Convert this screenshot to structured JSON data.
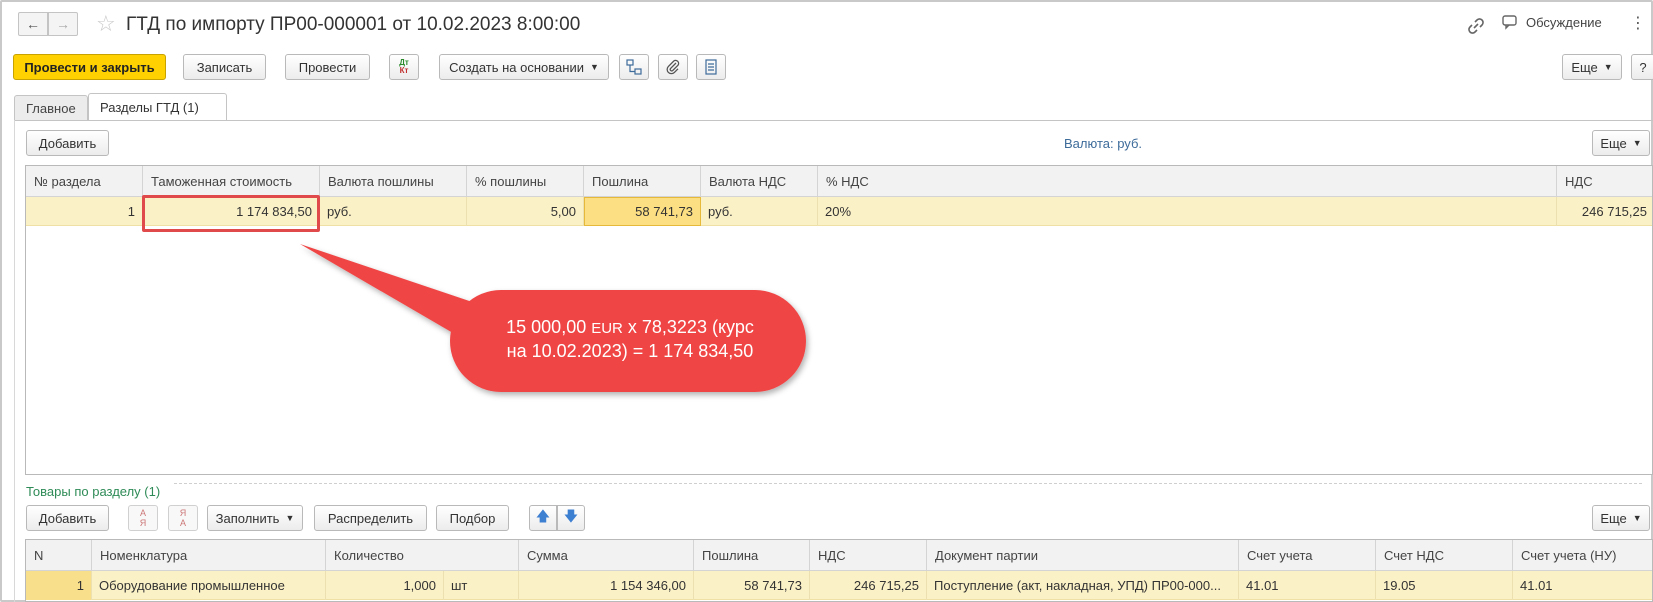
{
  "window": {
    "title": "ГТД по импорту ПР00-000001 от 10.02.2023 8:00:00",
    "discuss_label": "Обсуждение"
  },
  "toolbar": {
    "post_close_label": "Провести и закрыть",
    "save_label": "Записать",
    "post_label": "Провести",
    "dtkt_top": "Дт",
    "dtkt_bottom": "Кт",
    "create_based_label": "Создать на основании",
    "more_label": "Еще",
    "help_label": "?"
  },
  "tabs": [
    {
      "label": "Главное",
      "active": false
    },
    {
      "label": "Разделы ГТД (1)",
      "active": true
    }
  ],
  "sections": {
    "add_label": "Добавить",
    "currency_info": "Валюта: руб.",
    "more_label": "Еще",
    "columns": [
      "№ раздела",
      "Таможенная стоимость",
      "Валюта пошлины",
      "% пошлины",
      "Пошлина",
      "Валюта НДС",
      "% НДС",
      "НДС"
    ],
    "rows": [
      {
        "section_no": "1",
        "customs_value": "1 174 834,50",
        "duty_currency": "руб.",
        "duty_percent": "5,00",
        "duty": "58 741,73",
        "vat_currency": "руб.",
        "vat_percent": "20%",
        "vat": "246 715,25"
      }
    ]
  },
  "callout": {
    "line1_a": "15 000,00 ",
    "line1_unit": "EUR",
    "line1_b": " х 78,3223 (курс",
    "line2": "на 10.02.2023) = 1 174 834,50",
    "color": "#f04545"
  },
  "goods": {
    "title": "Товары по разделу (1)",
    "add_label": "Добавить",
    "sort_asc_top": "А",
    "sort_asc_bottom": "Я",
    "sort_desc_top": "Я",
    "sort_desc_bottom": "А",
    "fill_label": "Заполнить",
    "distribute_label": "Распределить",
    "select_label": "Подбор",
    "more_label": "Еще",
    "columns": [
      "N",
      "Номенклатура",
      "Количество",
      "Сумма",
      "Пошлина",
      "НДС",
      "Документ партии",
      "Счет учета",
      "Счет НДС",
      "Счет учета (НУ)"
    ],
    "rows": [
      {
        "n": "1",
        "item": "Оборудование промышленное",
        "qty": "1,000",
        "unit": "шт",
        "sum": "1 154 346,00",
        "duty": "58 741,73",
        "vat": "246 715,25",
        "batch_doc": "Поступление (акт, накладная, УПД) ПР00-000...",
        "account": "41.01",
        "vat_account": "19.05",
        "tax_account": "41.01"
      }
    ]
  },
  "colors": {
    "primary_button": "#ffd100",
    "row_highlight": "#fbf1c7",
    "current_cell": "#fcdf82",
    "annotation_red": "#e04a4a",
    "section_label_green": "#2e8b57",
    "currency_label_blue": "#3d6b9a"
  }
}
